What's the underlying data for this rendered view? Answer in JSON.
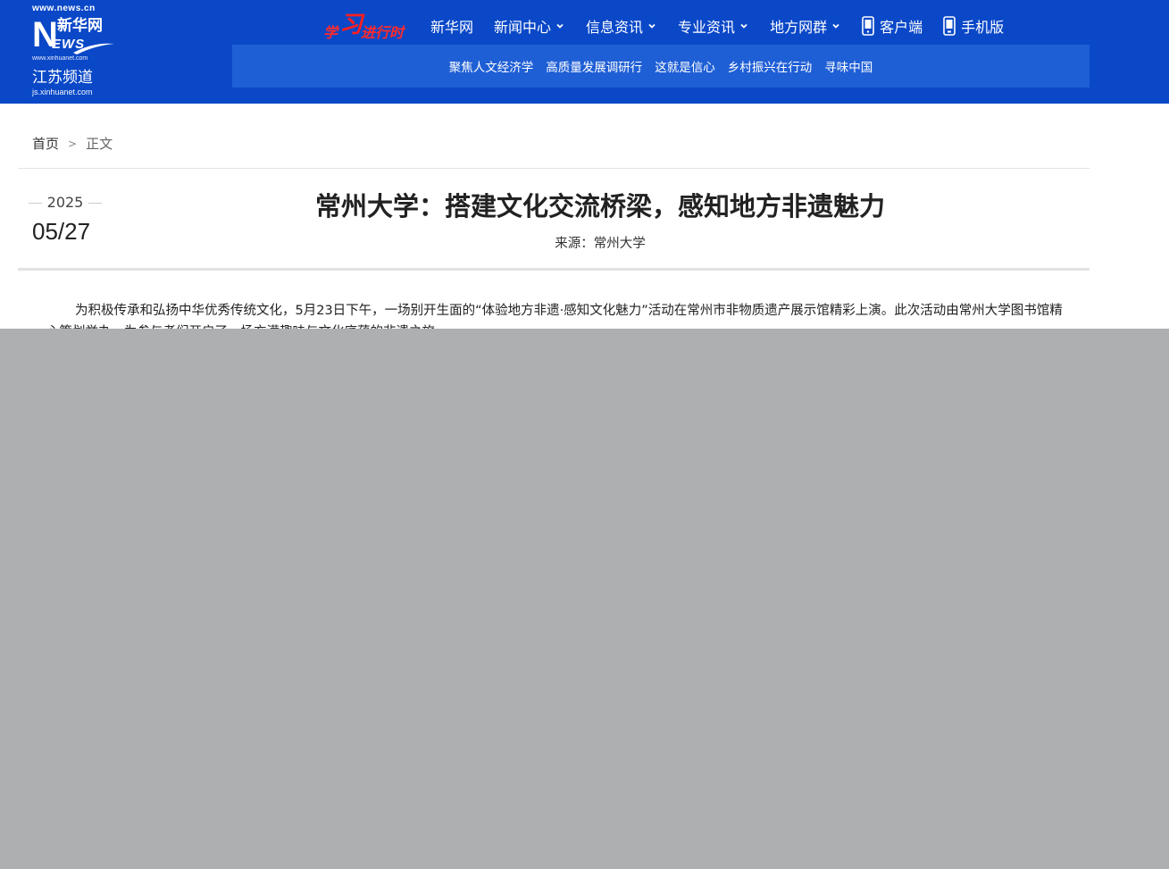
{
  "logo": {
    "url_top": "www.news.cn",
    "brand_cn": "新华网",
    "brand_n": "N",
    "brand_ews": "EWS",
    "url_mid": "www.xinhuanet.com",
    "channel": "江苏频道",
    "url_bottom": "js.xinhuanet.com"
  },
  "study_badge": {
    "xue": "学",
    "xi": "习",
    "rest": "进行时"
  },
  "topnav": [
    {
      "label": "新华网",
      "has_dropdown": false
    },
    {
      "label": "新闻中心",
      "has_dropdown": true
    },
    {
      "label": "信息资讯",
      "has_dropdown": true
    },
    {
      "label": "专业资讯",
      "has_dropdown": true
    },
    {
      "label": "地方网群",
      "has_dropdown": true
    },
    {
      "label": "客户端",
      "icon": "phone-icon"
    },
    {
      "label": "手机版",
      "icon": "mobile-icon"
    }
  ],
  "subnav": [
    "聚焦人文经济学",
    "高质量发展调研行",
    "这就是信心",
    "乡村振兴在行动",
    "寻味中国"
  ],
  "breadcrumb": {
    "home": "首页",
    "separator": ">",
    "current": "正文"
  },
  "article": {
    "year": "2025",
    "date": "05/27",
    "title": "常州大学：搭建文化交流桥梁，感知地方非遗魅力",
    "source": "来源：常州大学",
    "paragraph": "为积极传承和弘扬中华优秀传统文化，5月23日下午，一场别开生面的“体验地方非遗·感知文化魅力”活动在常州市非物质遗产展示馆精彩上演。此次活动由常州大学图书馆精心策划举办，为参与者们开启了一场充满趣味与文化底蕴的非遗之旅。"
  },
  "colors": {
    "header_bg": "#0a48c8",
    "subnav_bg": "#1f5fd6",
    "overlay": "#aeafb1",
    "badge_red": "#ff1f1f"
  }
}
